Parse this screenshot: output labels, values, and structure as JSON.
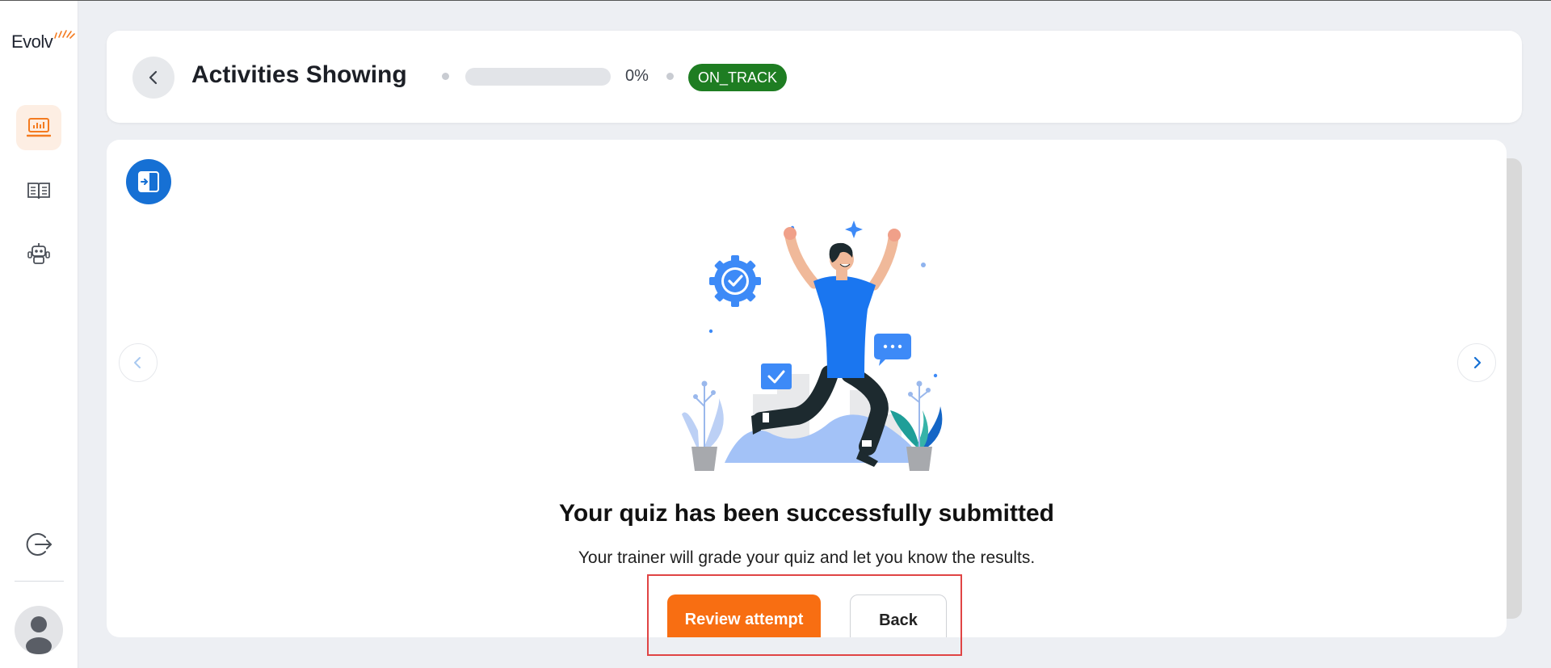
{
  "app": {
    "logo_text": "Evolv"
  },
  "sidebar": {
    "items": [
      {
        "name": "dashboard",
        "icon": "dashboard-chart-icon",
        "active": true
      },
      {
        "name": "courses",
        "icon": "book-icon",
        "active": false
      },
      {
        "name": "assistant",
        "icon": "robot-icon",
        "active": false
      }
    ],
    "logout_icon": "logout-icon",
    "avatar_icon": "user-avatar-icon"
  },
  "header": {
    "title": "Activities Showing",
    "progress_percent": 0,
    "progress_label": "0%",
    "status": "ON_TRACK",
    "status_color": "#1e7d22",
    "accent_color": "#f47b20"
  },
  "main": {
    "headline": "Your quiz has been successfully submitted",
    "subtext": "Your trainer will grade your quiz and let you know the results.",
    "primary_button": "Review attempt",
    "secondary_button": "Back",
    "primary_color": "#f86e12",
    "toggle_color": "#1670d4"
  }
}
